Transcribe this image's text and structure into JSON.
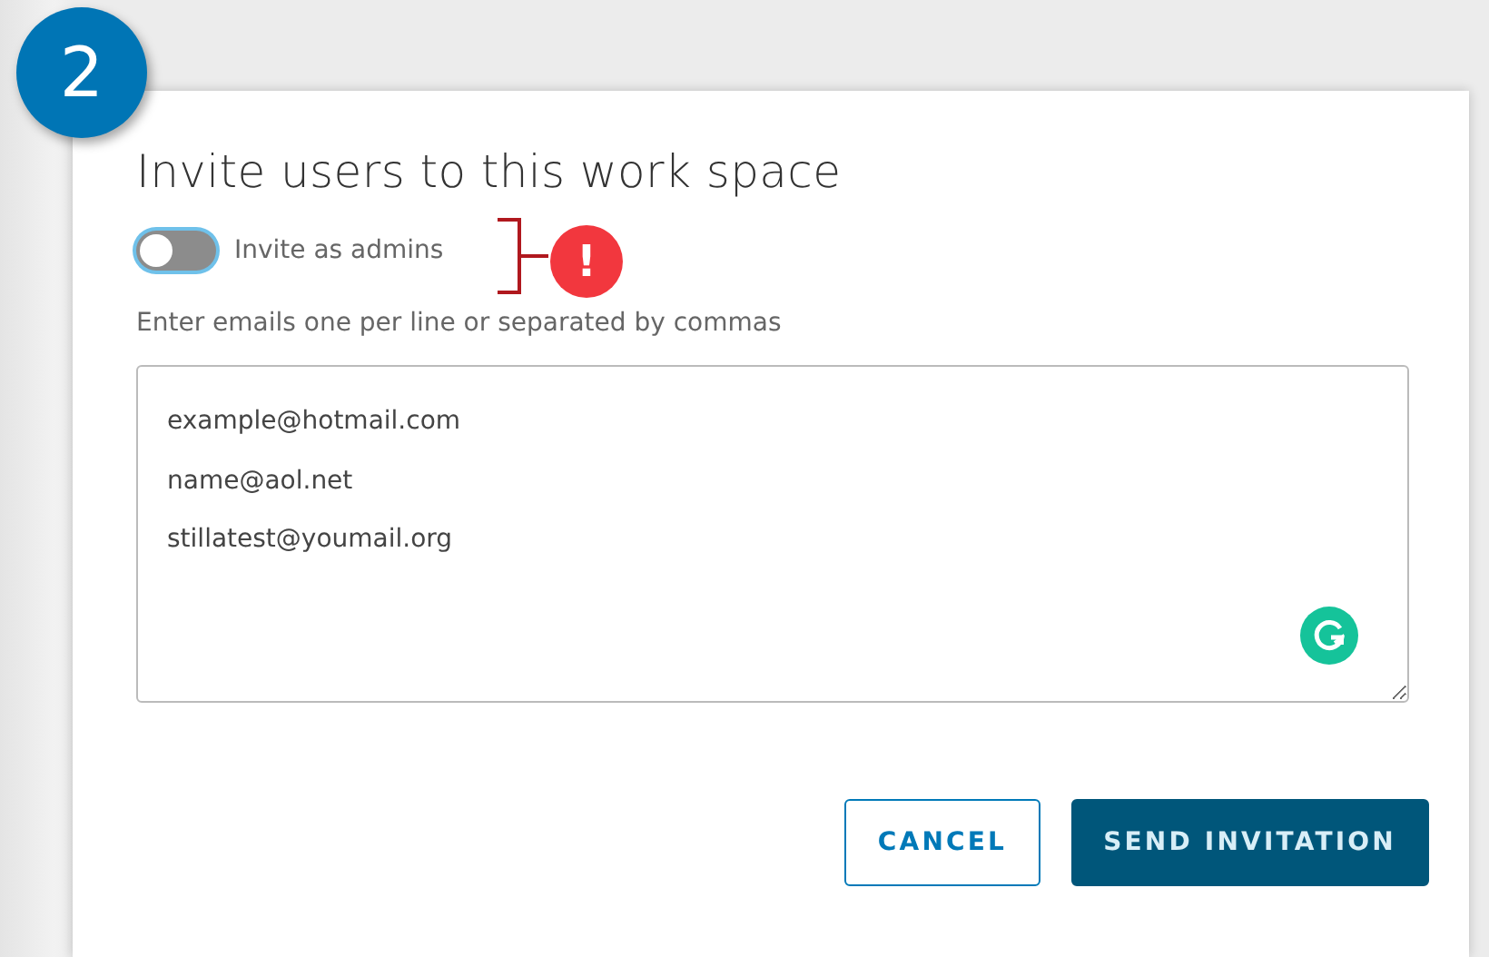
{
  "step_badge": "2",
  "dialog": {
    "title": "Invite users to this work space",
    "admin_toggle": {
      "label": "Invite as admins",
      "on": false
    },
    "warning_marker": "!",
    "hint": "Enter emails one per line or separated by commas",
    "emails": [
      "example@hotmail.com",
      "name@aol.net",
      "stillatest@youmail.org"
    ],
    "buttons": [
      {
        "label": "CANCEL",
        "kind": "outline"
      },
      {
        "label": "SEND INVITATION",
        "kind": "primary"
      }
    ]
  }
}
